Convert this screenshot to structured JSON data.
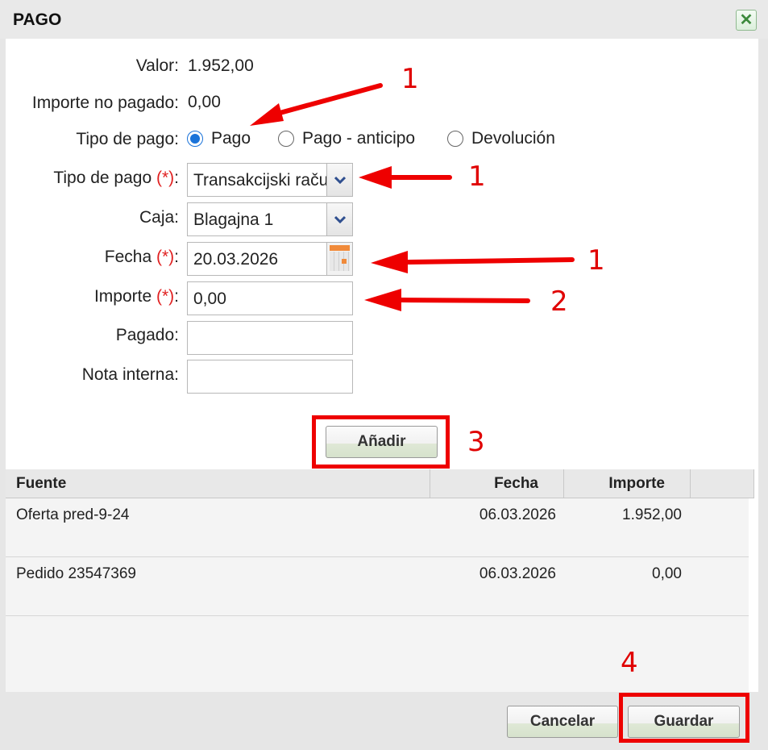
{
  "dialog": {
    "title": "PAGO",
    "close_symbol": "✕"
  },
  "form": {
    "valor_label": "Valor:",
    "valor_value": "1.952,00",
    "importe_no_pagado_label": "Importe no pagado:",
    "importe_no_pagado_value": "0,00",
    "tipo_pago_radio_label": "Tipo de pago:",
    "radio_options": [
      "Pago",
      "Pago - anticipo",
      "Devolución"
    ],
    "radio_selected": "Pago",
    "tipo_pago_select_label": "Tipo de pago",
    "tipo_pago_select_value": "Transakcijski račun",
    "caja_label": "Caja:",
    "caja_value": "Blagajna 1",
    "fecha_label": "Fecha",
    "fecha_value": "20.03.2026",
    "importe_label": "Importe",
    "importe_value": "0,00",
    "pagado_label": "Pagado:",
    "pagado_value": "",
    "nota_interna_label": "Nota interna:",
    "nota_interna_value": "",
    "required_marker": "(*)",
    "colon": ":"
  },
  "add_button_label": "Añadir",
  "grid": {
    "columns": [
      "Fuente",
      "Fecha",
      "Importe"
    ],
    "rows": [
      {
        "fuente": "Oferta pred-9-24",
        "fecha": "06.03.2026",
        "importe": "1.952,00"
      },
      {
        "fuente": "Pedido 23547369",
        "fecha": "06.03.2026",
        "importe": "0,00"
      }
    ]
  },
  "footer": {
    "cancel_label": "Cancelar",
    "save_label": "Guardar"
  },
  "annotations": {
    "numbers": [
      "1",
      "1",
      "1",
      "2",
      "3",
      "4"
    ],
    "color": "#e00000"
  },
  "icons": {
    "dropdown": "chevron-down-icon",
    "calendar": "calendar-icon",
    "close": "close-icon"
  }
}
